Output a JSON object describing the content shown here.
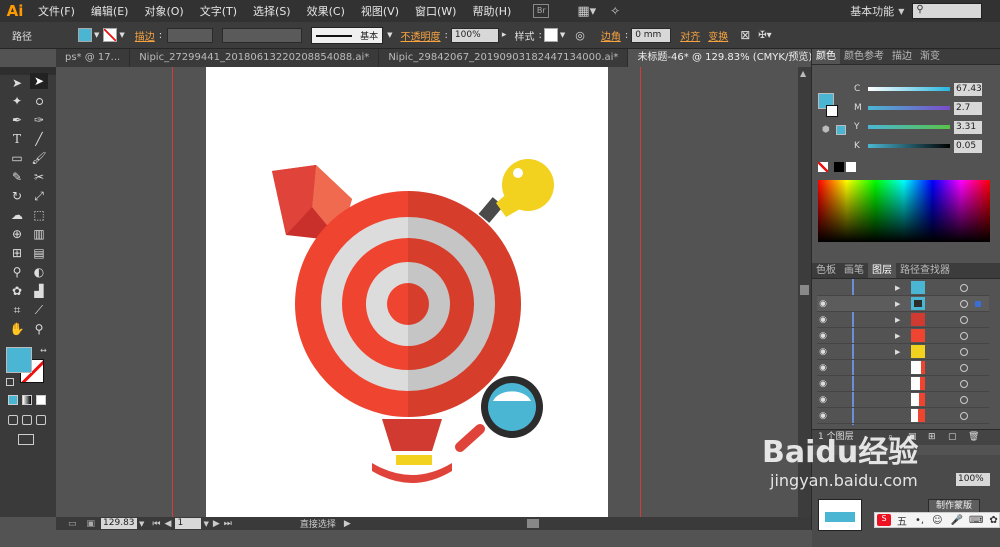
{
  "app": {
    "logo": "Ai",
    "workspace": "基本功能",
    "search_icon": "search-icon"
  },
  "menu": [
    "文件(F)",
    "编辑(E)",
    "对象(O)",
    "文字(T)",
    "选择(S)",
    "效果(C)",
    "视图(V)",
    "窗口(W)",
    "帮助(H)"
  ],
  "control": {
    "selection_label": "路径",
    "stroke_label": "描边",
    "stroke_style": "基本",
    "opacity_label": "不透明度",
    "opacity_value": "100%",
    "style_label": "样式",
    "corner_label": "边角",
    "corner_value": "0 mm",
    "align_label": "对齐",
    "transform_label": "变换",
    "fill_color": "#4bb6d3"
  },
  "tabs": [
    {
      "label": "ps* @ 17...",
      "active": false
    },
    {
      "label": "Nipic_27299441_20180613220208854088.ai*",
      "active": false
    },
    {
      "label": "Nipic_29842067_20190903182447134000.ai*",
      "active": false
    },
    {
      "label": "未标题-46* @ 129.83% (CMYK/预览)",
      "active": true
    }
  ],
  "status": {
    "zoom": "129.83",
    "page": "1",
    "tool": "直接选择"
  },
  "color_panel": {
    "tabs": [
      "颜色",
      "颜色参考",
      "描边",
      "渐变"
    ],
    "channels": [
      {
        "name": "C",
        "value": "67.43"
      },
      {
        "name": "M",
        "value": "2.7"
      },
      {
        "name": "Y",
        "value": "3.31"
      },
      {
        "name": "K",
        "value": "0.05"
      }
    ]
  },
  "layers_panel": {
    "tabs": [
      "色板",
      "画笔",
      "图层",
      "路径查找器"
    ],
    "count_label": "1 个图层"
  },
  "transparency": {
    "opacity_value": "100%",
    "make_mask": "制作蒙版"
  },
  "watermark": {
    "brand": "Baidu经验",
    "url": "jingyan.baidu.com"
  },
  "ime": {
    "label": "五"
  }
}
